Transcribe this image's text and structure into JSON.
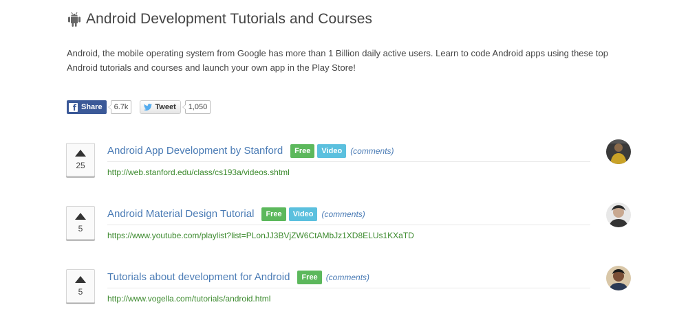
{
  "page": {
    "title": "Android Development Tutorials and Courses",
    "title_icon": "android-icon",
    "intro": "Android, the mobile operating system from Google has more than 1 Billion daily active users. Learn to code Android apps using these top Android tutorials and courses and launch your own app in the Play Store!"
  },
  "social": {
    "facebook": {
      "label": "Share",
      "count": "6.7k",
      "icon": "facebook-icon"
    },
    "twitter": {
      "label": "Tweet",
      "count": "1,050",
      "icon": "twitter-bird-icon"
    }
  },
  "items": [
    {
      "votes": "25",
      "title": "Android App Development by Stanford",
      "badges": [
        "Free",
        "Video"
      ],
      "comments": "(comments)",
      "url": "http://web.stanford.edu/class/cs193a/videos.shtml",
      "avatar_color": "#c9a227"
    },
    {
      "votes": "5",
      "title": "Android Material Design Tutorial",
      "badges": [
        "Free",
        "Video"
      ],
      "comments": "(comments)",
      "url": "https://www.youtube.com/playlist?list=PLonJJ3BVjZW6CtAMbJz1XD8ELUs1KXaTD",
      "avatar_color": "#5a5a5a"
    },
    {
      "votes": "5",
      "title": "Tutorials about development for Android",
      "badges": [
        "Free"
      ],
      "comments": "(comments)",
      "url": "http://www.vogella.com/tutorials/android.html",
      "avatar_color": "#6b4a3a"
    }
  ],
  "colors": {
    "link": "#4a7bb5",
    "url": "#3c8a2e",
    "badge_free": "#5cb85c",
    "badge_video": "#5bc0de",
    "facebook": "#3b5998"
  }
}
